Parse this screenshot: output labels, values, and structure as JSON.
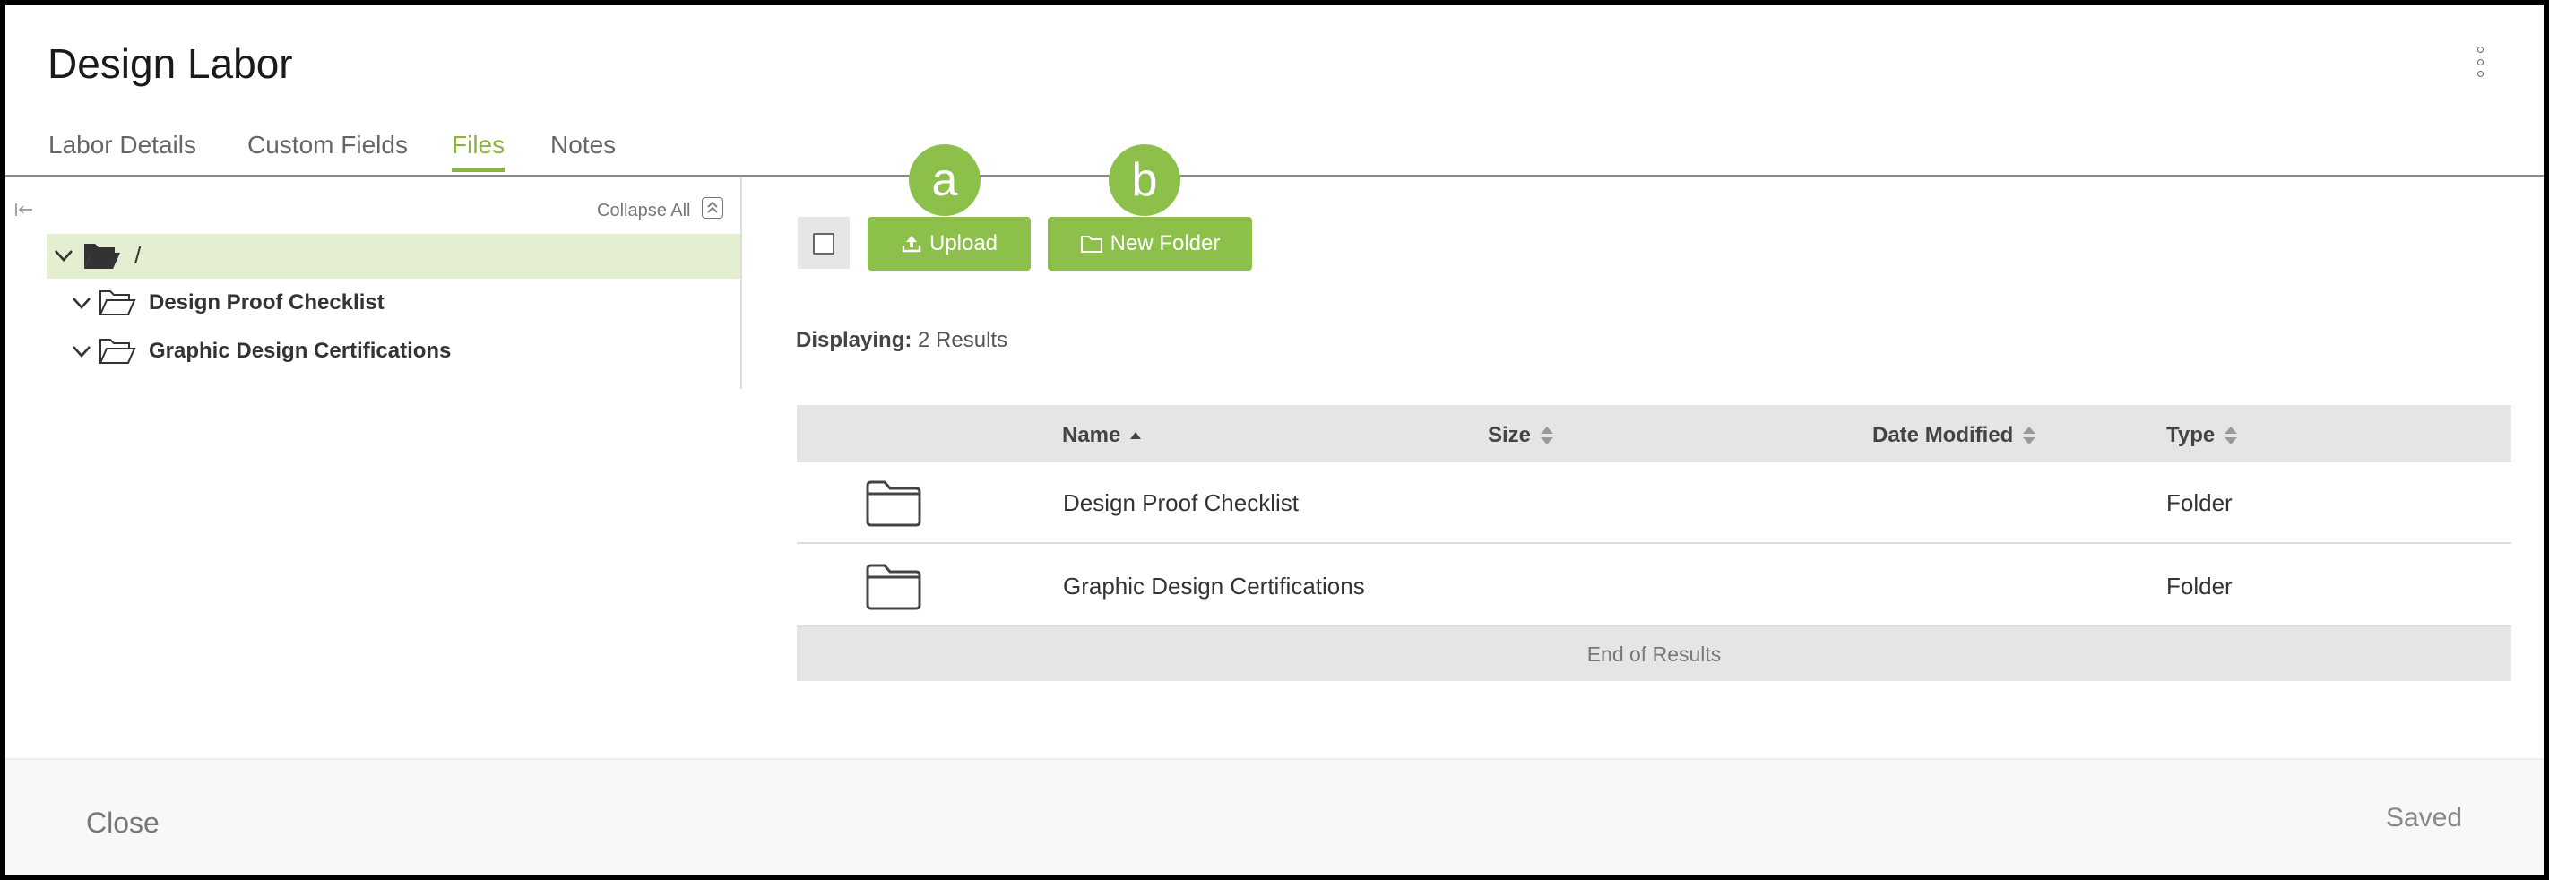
{
  "window": {
    "title": "Design Labor",
    "menu_icon": "kebab-vertical-icon"
  },
  "tabs": [
    {
      "label": "Labor Details",
      "active": false
    },
    {
      "label": "Custom Fields",
      "active": false
    },
    {
      "label": "Files",
      "active": true
    },
    {
      "label": "Notes",
      "active": false
    }
  ],
  "tree": {
    "collapse_all_label": "Collapse All",
    "root_label": "/",
    "items": [
      {
        "label": "Design Proof Checklist"
      },
      {
        "label": "Graphic Design Certifications"
      }
    ]
  },
  "toolbar": {
    "upload_label": "Upload",
    "new_folder_label": "New Folder",
    "badge_a": "a",
    "badge_b": "b"
  },
  "results": {
    "label": "Displaying:",
    "value": "2 Results"
  },
  "table": {
    "columns": [
      "Name",
      "Size",
      "Date Modified",
      "Type"
    ],
    "rows": [
      {
        "name": "Design Proof Checklist",
        "size": "",
        "date_modified": "",
        "type": "Folder"
      },
      {
        "name": "Graphic Design Certifications",
        "size": "",
        "date_modified": "",
        "type": "Folder"
      }
    ],
    "end_label": "End of Results"
  },
  "footer": {
    "close_label": "Close",
    "status_label": "Saved"
  },
  "colors": {
    "accent": "#8cc04b",
    "tab_active": "#8cb43c",
    "tree_selected": "#e4eed0"
  }
}
